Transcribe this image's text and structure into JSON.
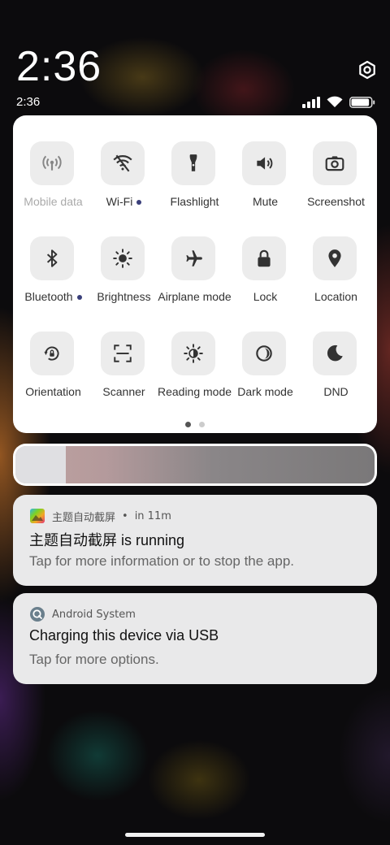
{
  "header": {
    "big_time": "2:36"
  },
  "status_bar": {
    "time": "2:36",
    "battery_level": 0.92
  },
  "quick_settings": {
    "tiles": [
      {
        "id": "mobile-data",
        "label": "Mobile data",
        "icon": "signal-tower-icon",
        "dimmed": true,
        "dot": false
      },
      {
        "id": "wifi",
        "label": "Wi-Fi",
        "icon": "wifi-off-icon",
        "dimmed": false,
        "dot": true
      },
      {
        "id": "flashlight",
        "label": "Flashlight",
        "icon": "flashlight-icon",
        "dimmed": false,
        "dot": false
      },
      {
        "id": "mute",
        "label": "Mute",
        "icon": "speaker-icon",
        "dimmed": false,
        "dot": false
      },
      {
        "id": "screenshot",
        "label": "Screenshot",
        "icon": "camera-icon",
        "dimmed": false,
        "dot": false
      },
      {
        "id": "bluetooth",
        "label": "Bluetooth",
        "icon": "bluetooth-icon",
        "dimmed": false,
        "dot": true
      },
      {
        "id": "brightness",
        "label": "Brightness",
        "icon": "sun-icon",
        "dimmed": false,
        "dot": false
      },
      {
        "id": "airplane",
        "label": "Airplane mode",
        "icon": "airplane-icon",
        "dimmed": false,
        "dot": false
      },
      {
        "id": "lock",
        "label": "Lock",
        "icon": "lock-icon",
        "dimmed": false,
        "dot": false
      },
      {
        "id": "location",
        "label": "Location",
        "icon": "location-pin-icon",
        "dimmed": false,
        "dot": false
      },
      {
        "id": "orientation",
        "label": "Orientation",
        "icon": "rotation-lock-icon",
        "dimmed": false,
        "dot": false
      },
      {
        "id": "scanner",
        "label": "Scanner",
        "icon": "scanner-icon",
        "dimmed": false,
        "dot": false
      },
      {
        "id": "reading-mode",
        "label": "Reading mode",
        "icon": "reading-sun-icon",
        "dimmed": false,
        "dot": false
      },
      {
        "id": "dark-mode",
        "label": "Dark mode",
        "icon": "dark-mode-icon",
        "dimmed": false,
        "dot": false
      },
      {
        "id": "dnd",
        "label": "DND",
        "icon": "moon-icon",
        "dimmed": false,
        "dot": false
      }
    ],
    "page_count": 2,
    "active_page": 0
  },
  "brightness_slider": {
    "level": 0.14
  },
  "notifications": [
    {
      "app": "主题自动截屏",
      "time": "in 11m",
      "title": "主题自动截屏 is running",
      "text": "Tap for more information or to stop the app.",
      "icon": "app-colorful-icon"
    },
    {
      "app": "Android System",
      "time": "",
      "title": "Charging this device via USB",
      "text": "Tap for more options.",
      "icon": "android-system-icon"
    }
  ],
  "colors": {
    "tile_bg": "#ececec",
    "panel_bg": "#ffffff",
    "dot_accent": "#3a3f7a",
    "notification_bg": "#e9e9ea"
  }
}
